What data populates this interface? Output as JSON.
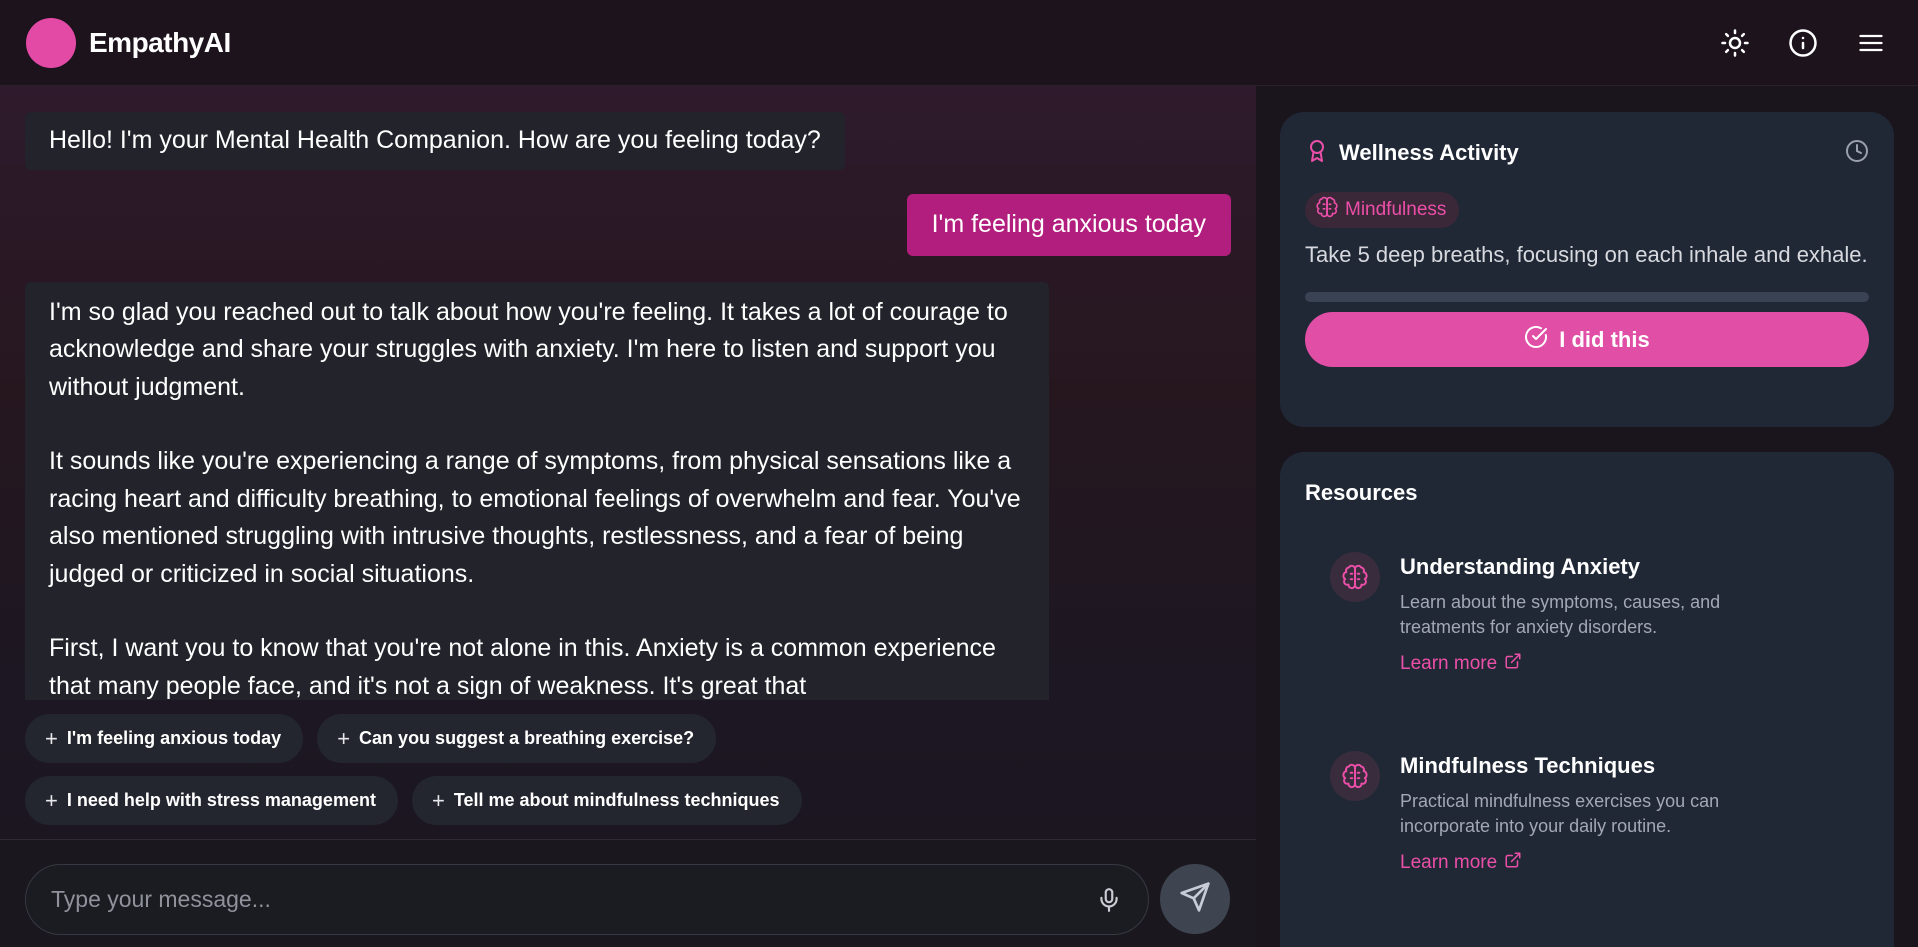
{
  "app": {
    "name": "EmpathyAI"
  },
  "chat": {
    "messages": [
      {
        "role": "bot",
        "text": "Hello! I'm your Mental Health Companion. How are you feeling today?"
      },
      {
        "role": "user",
        "text": "I'm feeling anxious today"
      },
      {
        "role": "bot",
        "paragraphs": [
          "I'm so glad you reached out to talk about how you're feeling. It takes a lot of courage to acknowledge and share your struggles with anxiety. I'm here to listen and support you without judgment.",
          "It sounds like you're experiencing a range of symptoms, from physical sensations like a racing heart and difficulty breathing, to emotional feelings of overwhelm and fear. You've also mentioned struggling with intrusive thoughts, restlessness, and a fear of being judged or criticized in social situations.",
          "First, I want you to know that you're not alone in this. Anxiety is a common experience that many people face, and it's not a sign of weakness. It's great that"
        ]
      }
    ],
    "suggestions": [
      "I'm feeling anxious today",
      "Can you suggest a breathing exercise?",
      "I need help with stress management",
      "Tell me about mindfulness techniques"
    ],
    "input": {
      "value": "",
      "placeholder": "Type your message..."
    }
  },
  "wellness": {
    "title": "Wellness Activity",
    "category": "Mindfulness",
    "activity": "Take 5 deep breaths, focusing on each inhale and exhale.",
    "progress": 0,
    "button_label": "I did this"
  },
  "resources": {
    "title": "Resources",
    "items": [
      {
        "title": "Understanding Anxiety",
        "description": "Learn about the symptoms, causes, and treatments for anxiety disorders.",
        "link": "Learn more"
      },
      {
        "title": "Mindfulness Techniques",
        "description": "Practical mindfulness exercises you can incorporate into your daily routine.",
        "link": "Learn more"
      }
    ]
  },
  "icons": {
    "logo": "logo-circle",
    "theme": "sun-icon",
    "info": "info-icon",
    "menu": "menu-icon",
    "award": "award-icon",
    "clock": "clock-icon",
    "brain": "brain-icon",
    "check": "check-circle-icon",
    "external": "external-link-icon",
    "mic": "mic-icon",
    "send": "send-icon"
  },
  "colors": {
    "accent": "#e24aa6",
    "user_bubble": "#b21e7d",
    "bot_bubble": "#22232b",
    "card": "#202836"
  }
}
